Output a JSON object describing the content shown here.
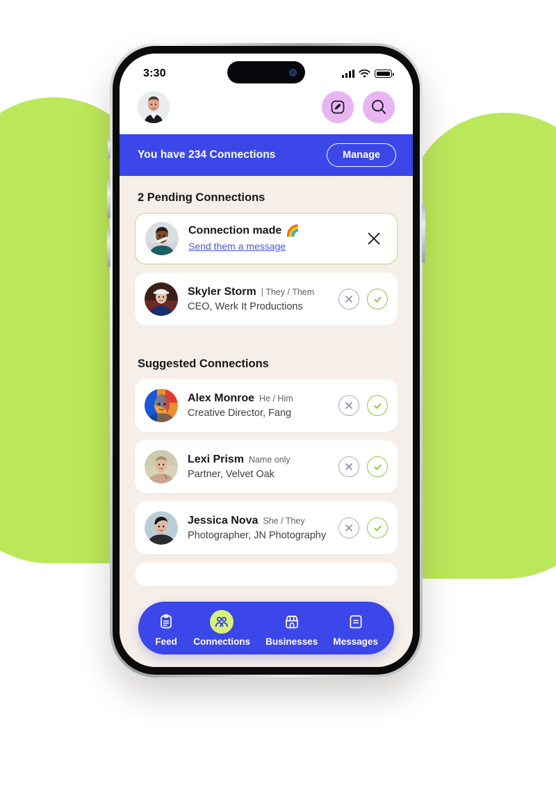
{
  "background": {
    "leaf_color": "#bbe85a",
    "page_bg": "#ffffff"
  },
  "theme": {
    "brand_blue": "#3b47e8",
    "lime": "#b9e04a",
    "lavender": "#e7b6f2",
    "screen_bg": "#f6efe9"
  },
  "status_bar": {
    "time": "3:30",
    "signal_icon": "cellular-signal-icon",
    "wifi_icon": "wifi-icon",
    "battery_icon": "battery-full-icon"
  },
  "header": {
    "avatar_name": "avatar",
    "compose_icon": "compose-edit-icon",
    "search_icon": "search-icon"
  },
  "banner": {
    "text": "You have 234 Connections",
    "connection_count": "234",
    "manage_label": "Manage"
  },
  "pending": {
    "title": "2 Pending Connections",
    "count": "2",
    "connection_made": {
      "title": "Connection made",
      "emoji": "🌈",
      "link": "Send them a message",
      "close_icon": "close-icon"
    },
    "items": [
      {
        "name": "Skyler Storm",
        "pronouns": "| They / Them",
        "role": "CEO, Werk It Productions",
        "decline_icon": "circle-x-icon",
        "accept_icon": "circle-check-icon"
      }
    ]
  },
  "suggested": {
    "title": "Suggested Connections",
    "items": [
      {
        "name": "Alex Monroe",
        "pronouns": "He / Him",
        "role": "Creative Director, Fang",
        "decline_icon": "circle-x-icon",
        "accept_icon": "circle-check-icon"
      },
      {
        "name": "Lexi Prism",
        "pronouns": "Name only",
        "role": "Partner, Velvet Oak",
        "decline_icon": "circle-x-icon",
        "accept_icon": "circle-check-icon"
      },
      {
        "name": "Jessica Nova",
        "pronouns": "She / They",
        "role": "Photographer, JN Photography",
        "decline_icon": "circle-x-icon",
        "accept_icon": "circle-check-icon"
      }
    ]
  },
  "bottom_nav": {
    "items": [
      {
        "label": "Feed",
        "icon": "feed-clipboard-icon",
        "active": false
      },
      {
        "label": "Connections",
        "icon": "people-icon",
        "active": true
      },
      {
        "label": "Businesses",
        "icon": "storefront-icon",
        "active": false
      },
      {
        "label": "Messages",
        "icon": "message-icon",
        "active": false
      }
    ]
  }
}
